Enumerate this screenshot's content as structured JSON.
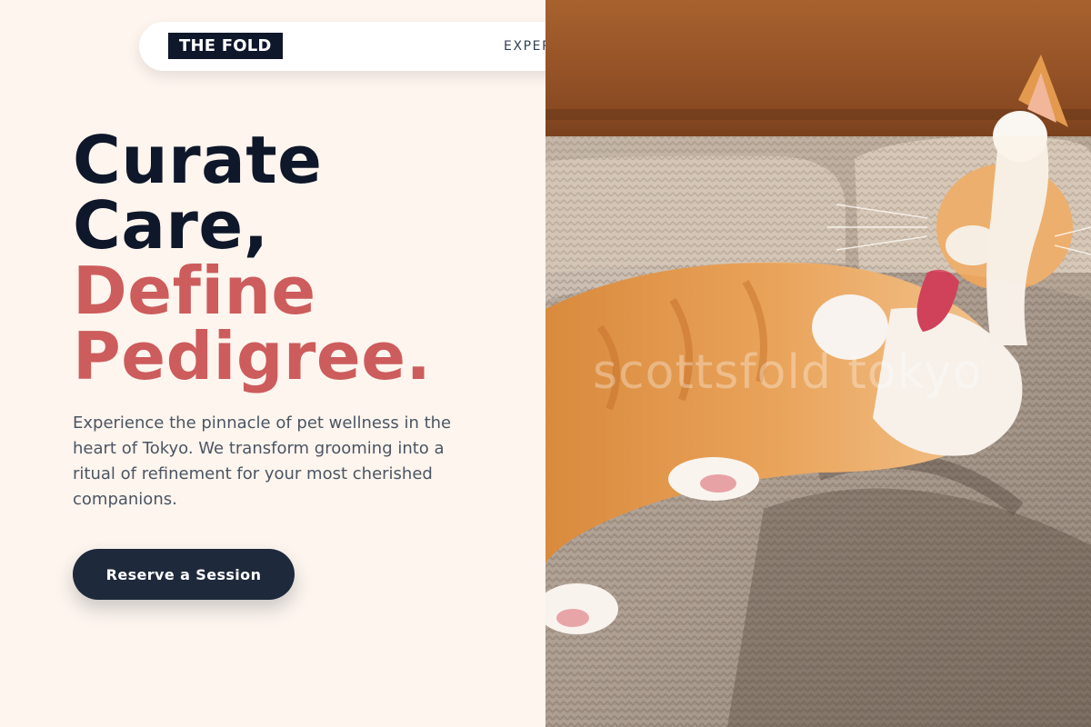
{
  "nav": {
    "logo": "THE FOLD",
    "link_partial": "EXPER"
  },
  "hero": {
    "title_line1": "Curate",
    "title_line2": "Care,",
    "title_line3": "Define",
    "title_line4": "Pedigree.",
    "description": "Experience the pinnacle of pet wellness in the heart of Tokyo. We transform grooming into a ritual of refinement for your most cherished companions.",
    "cta_label": "Reserve a Session"
  },
  "photo": {
    "subject": "orange-white-cat-on-sofa",
    "watermark": "scottsfold tokyo"
  },
  "colors": {
    "background": "#fdf5ee",
    "ink": "#0f172a",
    "accent": "#cd5c5c",
    "button": "#1e293b",
    "body_text": "#4b5563"
  }
}
